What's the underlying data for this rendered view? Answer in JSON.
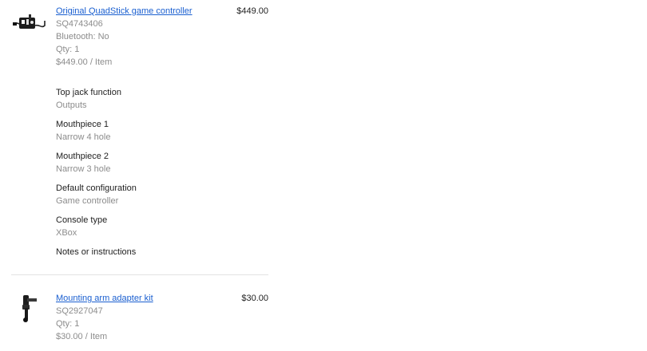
{
  "items": [
    {
      "title": "Original QuadStick game controller",
      "sku": "SQ4743406",
      "bluetooth": "Bluetooth: No",
      "qty": "Qty: 1",
      "unit_price": "$449.00 / Item",
      "price": "$449.00",
      "icon": "game-controller-icon",
      "options": [
        {
          "label": "Top jack function",
          "value": "Outputs"
        },
        {
          "label": "Mouthpiece 1",
          "value": "Narrow 4 hole"
        },
        {
          "label": "Mouthpiece 2",
          "value": "Narrow 3 hole"
        },
        {
          "label": "Default configuration",
          "value": "Game controller"
        },
        {
          "label": "Console type",
          "value": "XBox"
        },
        {
          "label": "Notes or instructions",
          "value": ""
        }
      ]
    },
    {
      "title": "Mounting arm adapter kit",
      "sku": "SQ2927047",
      "qty": "Qty: 1",
      "unit_price": "$30.00 / Item",
      "price": "$30.00",
      "icon": "mounting-arm-icon"
    }
  ],
  "colors": {
    "link": "#1a5fd0",
    "muted": "#8c8c8c",
    "text": "#222222",
    "divider": "#e2e2e2"
  }
}
